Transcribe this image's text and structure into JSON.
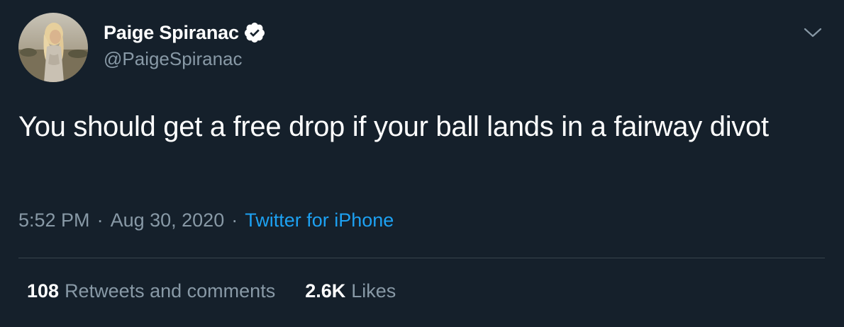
{
  "author": {
    "display_name": "Paige Spiranac",
    "handle": "@PaigeSpiranac",
    "verified": true,
    "verified_color": "#ffffff",
    "avatar": "profile-photo"
  },
  "tweet": {
    "text": "You should get a free drop if your ball lands in a fairway divot",
    "time": "5:52 PM",
    "separator": "·",
    "date": "Aug 30, 2020",
    "source": "Twitter for iPhone"
  },
  "stats": {
    "retweets_count": "108",
    "retweets_label": "Retweets and comments",
    "likes_count": "2.6K",
    "likes_label": "Likes"
  },
  "icons": {
    "caret": "chevron-down-icon",
    "verified": "verified-badge-icon"
  },
  "colors": {
    "background": "#15202b",
    "text_primary": "#ffffff",
    "text_secondary": "#8899a6",
    "link": "#1da1f2",
    "divider": "#38444d"
  }
}
